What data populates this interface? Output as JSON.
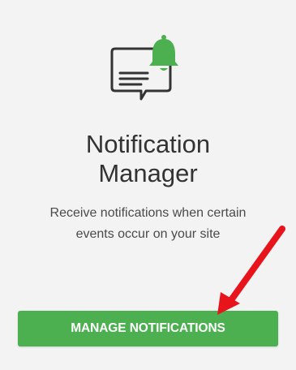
{
  "card": {
    "title_line1": "Notification",
    "title_line2": "Manager",
    "description_line1": "Receive notifications when certain",
    "description_line2": "events occur on your site",
    "button_label": "MANAGE NOTIFICATIONS"
  },
  "icons": {
    "hero": "message-bell-icon",
    "annotation": "red-arrow"
  },
  "colors": {
    "accent": "#4caf50",
    "bell": "#4caf50",
    "arrow": "#e8141c",
    "title": "#333333",
    "background": "#f3f3f3"
  }
}
